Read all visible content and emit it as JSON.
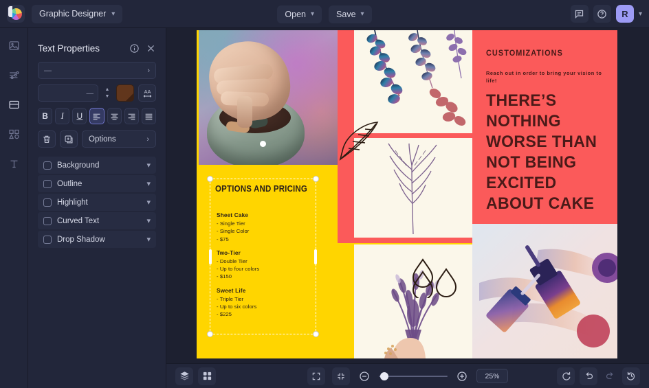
{
  "topbar": {
    "logo_icon": "color-wheel-logo",
    "document_title": "Graphic Designer",
    "title_chevron_icon": "chevron-down-icon",
    "open_label": "Open",
    "save_label": "Save",
    "comment_icon": "comment-icon",
    "help_icon": "help-circle-icon",
    "avatar_initial": "R",
    "avatar_color": "#9d9bf5",
    "account_chevron_icon": "chevron-down-icon"
  },
  "rail": {
    "items": [
      {
        "name": "image-tool",
        "icon": "image-icon",
        "active": false
      },
      {
        "name": "adjustments-tool",
        "icon": "sliders-icon",
        "active": false
      },
      {
        "name": "layout-tool",
        "icon": "layout-icon",
        "active": true
      },
      {
        "name": "shapes-tool",
        "icon": "shapes-icon",
        "active": false
      },
      {
        "name": "text-tool",
        "icon": "text-icon",
        "active": false
      }
    ]
  },
  "panel": {
    "title": "Text Properties",
    "info_icon": "info-circle-icon",
    "close_icon": "close-icon",
    "font_family_value": "—",
    "font_family_chevron": "chevron-right-icon",
    "font_size_value": "—",
    "stepper_up_icon": "chevron-up-icon",
    "stepper_down_icon": "chevron-down-icon",
    "color_swatch": "#61361c",
    "letter_spacing_icon": "AA",
    "format_buttons": [
      {
        "name": "bold-button",
        "label": "B",
        "active": false
      },
      {
        "name": "italic-button",
        "label": "I",
        "active": false
      },
      {
        "name": "underline-button",
        "label": "U",
        "active": false
      },
      {
        "name": "align-left-button",
        "label": "align-left-icon",
        "active": true
      },
      {
        "name": "align-center-button",
        "label": "align-center-icon",
        "active": false
      },
      {
        "name": "align-right-button",
        "label": "align-right-icon",
        "active": false
      },
      {
        "name": "align-justify-button",
        "label": "align-justify-icon",
        "active": false
      }
    ],
    "delete_icon": "trash-icon",
    "duplicate_icon": "duplicate-icon",
    "options_label": "Options",
    "options_chevron": "chevron-right-icon",
    "accordions": [
      {
        "label": "Background",
        "checked": false,
        "chevron": "chevron-down-icon"
      },
      {
        "label": "Outline",
        "checked": false,
        "chevron": "chevron-down-icon"
      },
      {
        "label": "Highlight",
        "checked": false,
        "chevron": "chevron-down-icon"
      },
      {
        "label": "Curved Text",
        "checked": false,
        "chevron": "chevron-down-icon"
      },
      {
        "label": "Drop Shadow",
        "checked": false,
        "chevron": "chevron-down-icon"
      }
    ]
  },
  "artboard": {
    "colors": {
      "yellow": "#ffd500",
      "red": "#fb5a5a",
      "cream": "#fbf7ea",
      "ink": "#4a1a18"
    },
    "text_block": {
      "title": "OPTIONS AND PRICING",
      "groups": [
        {
          "heading": "Sheet Cake",
          "items": [
            "- Single Tier",
            "- Single Color",
            "- $75"
          ]
        },
        {
          "heading": "Two-Tier",
          "items": [
            "- Double Tier",
            "- Up to four colors",
            "- $150"
          ]
        },
        {
          "heading": "Sweet Life",
          "items": [
            "- Triple Tier",
            "- Up to six colors",
            "- $225"
          ]
        }
      ]
    },
    "right_panel": {
      "kicker": "CUSTOMIZATIONS",
      "subtitle": "Reach out in order to bring your vision to life!",
      "headline": "THERE’S NOTHING WORSE THAN NOT BEING EXCITED ABOUT CAKE"
    },
    "images": [
      {
        "name": "mortar-and-pestle-photo"
      },
      {
        "name": "eucalyptus-botanical-photo"
      },
      {
        "name": "lavender-sprig-photo"
      },
      {
        "name": "lavender-bouquet-photo"
      },
      {
        "name": "dropper-bottles-photo"
      }
    ],
    "line_art": [
      {
        "name": "leaf-line-art"
      },
      {
        "name": "water-drops-line-art"
      }
    ]
  },
  "bottombar": {
    "layers_icon": "layers-icon",
    "grid_icon": "grid-icon",
    "fit_screen_icon": "fit-screen-icon",
    "collapse_icon": "collapse-icon",
    "zoom_out_icon": "zoom-out-icon",
    "zoom_in_icon": "zoom-in-icon",
    "zoom_value": "25%",
    "slider_position_percent": 4,
    "reset_icon": "reset-icon",
    "undo_icon": "undo-icon",
    "redo_icon": "redo-icon",
    "history_icon": "history-icon"
  }
}
